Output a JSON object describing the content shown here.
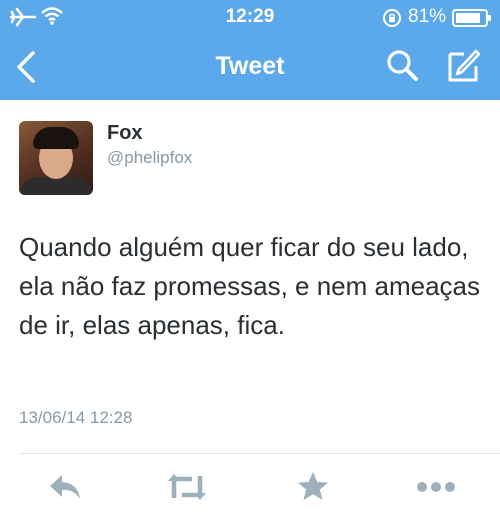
{
  "status_bar": {
    "time": "12:29",
    "battery": "81%",
    "icons": [
      "airplane-icon",
      "wifi-icon",
      "rotation-lock-icon",
      "battery-icon"
    ]
  },
  "nav": {
    "title": "Tweet",
    "icons": [
      "back-icon",
      "search-icon",
      "compose-icon"
    ]
  },
  "tweet": {
    "author_name": "Fox",
    "author_handle": "@phelipfox",
    "text": "Quando alguém quer ficar do seu lado, ela não faz promessas, e nem ameaças de ir, elas apenas, fica.",
    "timestamp": "13/06/14 12:28"
  },
  "actions": [
    "reply-icon",
    "retweet-icon",
    "favorite-icon",
    "more-icon"
  ],
  "colors": {
    "header": "#5ba8ea",
    "text": "#292f33",
    "meta": "#8899a6",
    "action_icons": "#9fb0bd"
  }
}
